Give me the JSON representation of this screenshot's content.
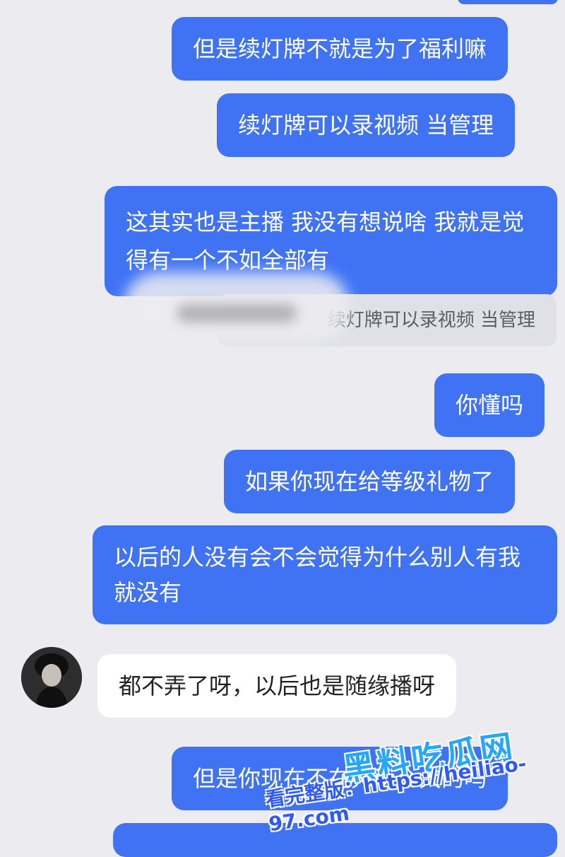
{
  "colors": {
    "background": "#ececf0",
    "outgoing_bubble": "#3f73f4",
    "incoming_bubble": "#ffffff",
    "quote_background": "#e0e1e6",
    "watermark_title": "#25a6ff",
    "watermark_sub": "#2f58ff"
  },
  "messages": [
    {
      "sender": "me",
      "text": "但是续灯牌不就是为了福利嘛"
    },
    {
      "sender": "me",
      "text": "续灯牌可以录视频 当管理"
    },
    {
      "sender": "me",
      "text": "这其实也是主播 我没有想说啥 我就是觉得有一个不如全部有"
    },
    {
      "sender": "me",
      "text": "你懂吗"
    },
    {
      "sender": "me",
      "text": "如果你现在给等级礼物了"
    },
    {
      "sender": "me",
      "text": "以后的人没有会不会觉得为什么别人有我就没有"
    },
    {
      "sender": "other",
      "text": "都不弄了呀，以后也是随缘播呀"
    },
    {
      "sender": "me",
      "text": "但是你现在不在弄两个大的吗"
    }
  ],
  "quote": {
    "text": "续灯牌可以录视频 当管理"
  },
  "watermark": {
    "title": "黑料吃瓜网",
    "line": "看完整版：https://heiliao-97.com"
  }
}
